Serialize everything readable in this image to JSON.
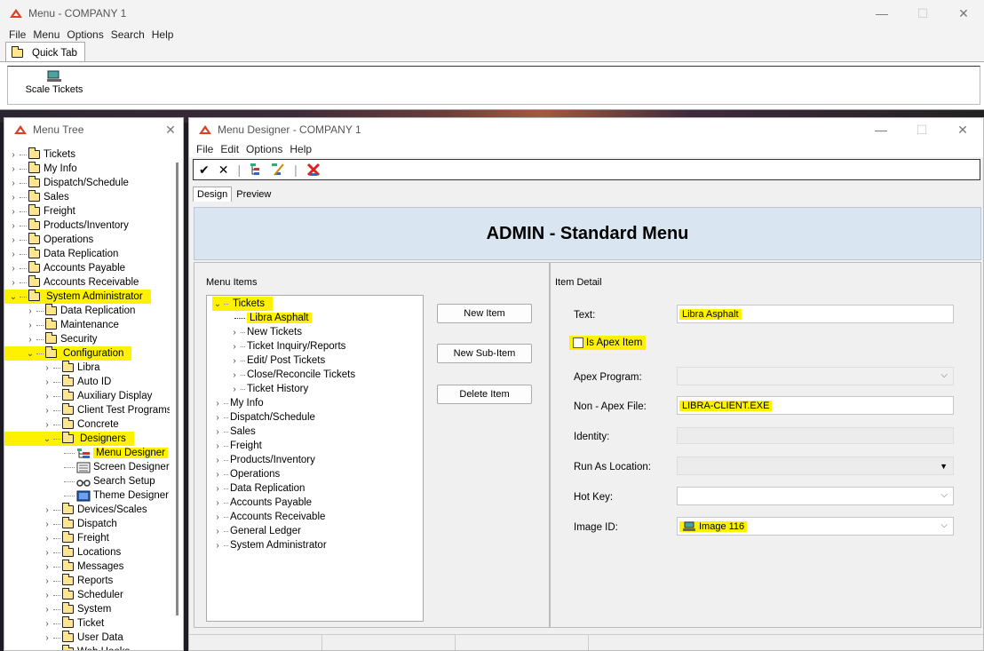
{
  "main_window": {
    "title": "Menu - COMPANY 1",
    "menu": [
      "File",
      "Menu",
      "Options",
      "Search",
      "Help"
    ],
    "quick_tab_label": "Quick Tab",
    "ribbon_button": "Scale Tickets"
  },
  "tree_window": {
    "title": "Menu Tree",
    "items": [
      {
        "label": "Tickets",
        "depth": 0,
        "expanded": false,
        "highlight": false
      },
      {
        "label": "My Info",
        "depth": 0,
        "expanded": false,
        "highlight": false
      },
      {
        "label": "Dispatch/Schedule",
        "depth": 0,
        "expanded": false,
        "highlight": false
      },
      {
        "label": "Sales",
        "depth": 0,
        "expanded": false,
        "highlight": false
      },
      {
        "label": "Freight",
        "depth": 0,
        "expanded": false,
        "highlight": false
      },
      {
        "label": "Products/Inventory",
        "depth": 0,
        "expanded": false,
        "highlight": false
      },
      {
        "label": "Operations",
        "depth": 0,
        "expanded": false,
        "highlight": false
      },
      {
        "label": "Data Replication",
        "depth": 0,
        "expanded": false,
        "highlight": false
      },
      {
        "label": "Accounts Payable",
        "depth": 0,
        "expanded": false,
        "highlight": false
      },
      {
        "label": "Accounts Receivable",
        "depth": 0,
        "expanded": false,
        "highlight": false
      },
      {
        "label": "System Administrator",
        "depth": 0,
        "expanded": true,
        "highlight": true
      },
      {
        "label": "Data Replication",
        "depth": 1,
        "expanded": false,
        "highlight": false
      },
      {
        "label": "Maintenance",
        "depth": 1,
        "expanded": false,
        "highlight": false
      },
      {
        "label": "Security",
        "depth": 1,
        "expanded": false,
        "highlight": false
      },
      {
        "label": "Configuration",
        "depth": 1,
        "expanded": true,
        "highlight": true
      },
      {
        "label": "Libra",
        "depth": 2,
        "expanded": false,
        "highlight": false
      },
      {
        "label": "Auto ID",
        "depth": 2,
        "expanded": false,
        "highlight": false
      },
      {
        "label": "Auxiliary Display",
        "depth": 2,
        "expanded": false,
        "highlight": false
      },
      {
        "label": "Client Test Programs",
        "depth": 2,
        "expanded": false,
        "highlight": false
      },
      {
        "label": "Concrete",
        "depth": 2,
        "expanded": false,
        "highlight": false
      },
      {
        "label": "Designers",
        "depth": 2,
        "expanded": true,
        "highlight": true
      },
      {
        "label": "Menu Designer",
        "depth": 3,
        "leaf": true,
        "icon": "menu-designer-icon",
        "highlight": true
      },
      {
        "label": "Screen Designer",
        "depth": 3,
        "leaf": true,
        "icon": "screen-designer-icon",
        "highlight": false
      },
      {
        "label": "Search Setup",
        "depth": 3,
        "leaf": true,
        "icon": "binoculars-icon",
        "highlight": false
      },
      {
        "label": "Theme Designer",
        "depth": 3,
        "leaf": true,
        "icon": "theme-designer-icon",
        "highlight": false
      },
      {
        "label": "Devices/Scales",
        "depth": 2,
        "expanded": false,
        "highlight": false
      },
      {
        "label": "Dispatch",
        "depth": 2,
        "expanded": false,
        "highlight": false
      },
      {
        "label": "Freight",
        "depth": 2,
        "expanded": false,
        "highlight": false
      },
      {
        "label": "Locations",
        "depth": 2,
        "expanded": false,
        "highlight": false
      },
      {
        "label": "Messages",
        "depth": 2,
        "expanded": false,
        "highlight": false
      },
      {
        "label": "Reports",
        "depth": 2,
        "expanded": false,
        "highlight": false
      },
      {
        "label": "Scheduler",
        "depth": 2,
        "expanded": false,
        "highlight": false
      },
      {
        "label": "System",
        "depth": 2,
        "expanded": false,
        "highlight": false
      },
      {
        "label": "Ticket",
        "depth": 2,
        "expanded": false,
        "highlight": false
      },
      {
        "label": "User Data",
        "depth": 2,
        "expanded": false,
        "highlight": false
      },
      {
        "label": "Web Hooks",
        "depth": 2,
        "expanded": false,
        "highlight": false
      }
    ]
  },
  "designer_window": {
    "title": "Menu Designer - COMPANY 1",
    "menu": [
      "File",
      "Edit",
      "Options",
      "Help"
    ],
    "tabs": [
      "Design",
      "Preview"
    ],
    "header": "ADMIN - Standard Menu",
    "menu_items_label": "Menu Items",
    "menu_items": [
      {
        "label": "Tickets",
        "depth": 0,
        "expanded": true,
        "highlight": true
      },
      {
        "label": "Libra Asphalt",
        "depth": 1,
        "leaf": true,
        "highlight": true
      },
      {
        "label": "New Tickets",
        "depth": 1,
        "highlight": false
      },
      {
        "label": "Ticket Inquiry/Reports",
        "depth": 1,
        "highlight": false
      },
      {
        "label": "Edit/ Post Tickets",
        "depth": 1,
        "highlight": false
      },
      {
        "label": "Close/Reconcile Tickets",
        "depth": 1,
        "highlight": false
      },
      {
        "label": "Ticket History",
        "depth": 1,
        "highlight": false
      },
      {
        "label": "My Info",
        "depth": 0,
        "highlight": false
      },
      {
        "label": "Dispatch/Schedule",
        "depth": 0,
        "highlight": false
      },
      {
        "label": "Sales",
        "depth": 0,
        "highlight": false
      },
      {
        "label": "Freight",
        "depth": 0,
        "highlight": false
      },
      {
        "label": "Products/Inventory",
        "depth": 0,
        "highlight": false
      },
      {
        "label": "Operations",
        "depth": 0,
        "highlight": false
      },
      {
        "label": "Data Replication",
        "depth": 0,
        "highlight": false
      },
      {
        "label": "Accounts Payable",
        "depth": 0,
        "highlight": false
      },
      {
        "label": "Accounts Receivable",
        "depth": 0,
        "highlight": false
      },
      {
        "label": "General Ledger",
        "depth": 0,
        "highlight": false
      },
      {
        "label": "System Administrator",
        "depth": 0,
        "highlight": false
      }
    ],
    "buttons": {
      "new_item": "New Item",
      "new_sub_item": "New Sub-Item",
      "delete_item": "Delete Item"
    },
    "item_detail": {
      "group_label": "Item Detail",
      "text_label": "Text:",
      "text_value": "Libra Asphalt",
      "apex_checkbox_label": "Is Apex Item",
      "apex_checked": false,
      "apex_program_label": "Apex Program:",
      "apex_program_value": "",
      "non_apex_label": "Non - Apex File:",
      "non_apex_value": "LIBRA-CLIENT.EXE",
      "identity_label": "Identity:",
      "identity_value": "",
      "run_as_label": "Run As Location:",
      "run_as_value": "",
      "hot_key_label": "Hot Key:",
      "hot_key_value": "",
      "image_id_label": "Image ID:",
      "image_id_value": "Image 116"
    }
  },
  "colors": {
    "highlight": "#fff200",
    "header_band": "#d9e6f2",
    "logo_red": "#d9412b"
  }
}
